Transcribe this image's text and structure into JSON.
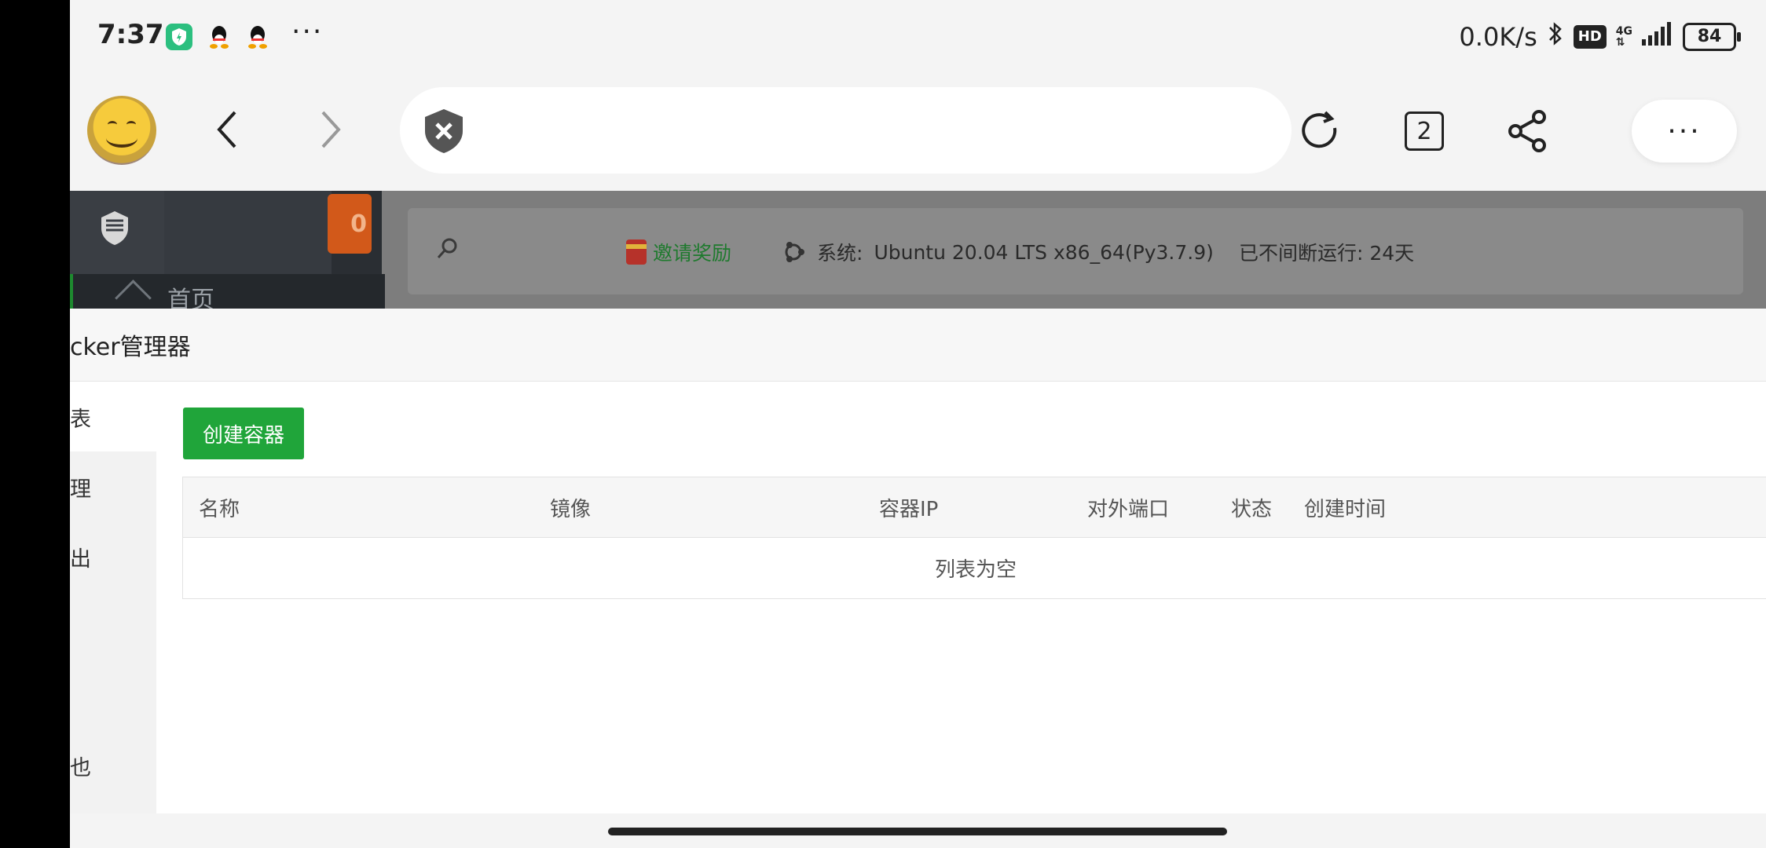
{
  "status_bar": {
    "time": "7:37",
    "overflow": "···",
    "net_speed": "0.0K/s",
    "hd": "HD",
    "network_type": "4G",
    "battery": "84"
  },
  "browser": {
    "tab_count": "2",
    "more": "···"
  },
  "panel": {
    "badge": "0",
    "home_label": "首页",
    "invite_label": "邀请奖励",
    "system_label": "系统:",
    "system_value": "Ubuntu 20.04 LTS x86_64(Py3.7.9)",
    "uptime": "已不间断运行: 24天",
    "colors": {
      "invite": "#1f7a2e",
      "accent": "#20a53a"
    }
  },
  "page": {
    "title": "cker管理器",
    "subnav": [
      "表",
      "理",
      "出",
      "也"
    ],
    "create_button": "创建容器",
    "table": {
      "columns": [
        "名称",
        "镜像",
        "容器IP",
        "对外端口",
        "状态",
        "创建时间"
      ],
      "empty_text": "列表为空"
    }
  }
}
